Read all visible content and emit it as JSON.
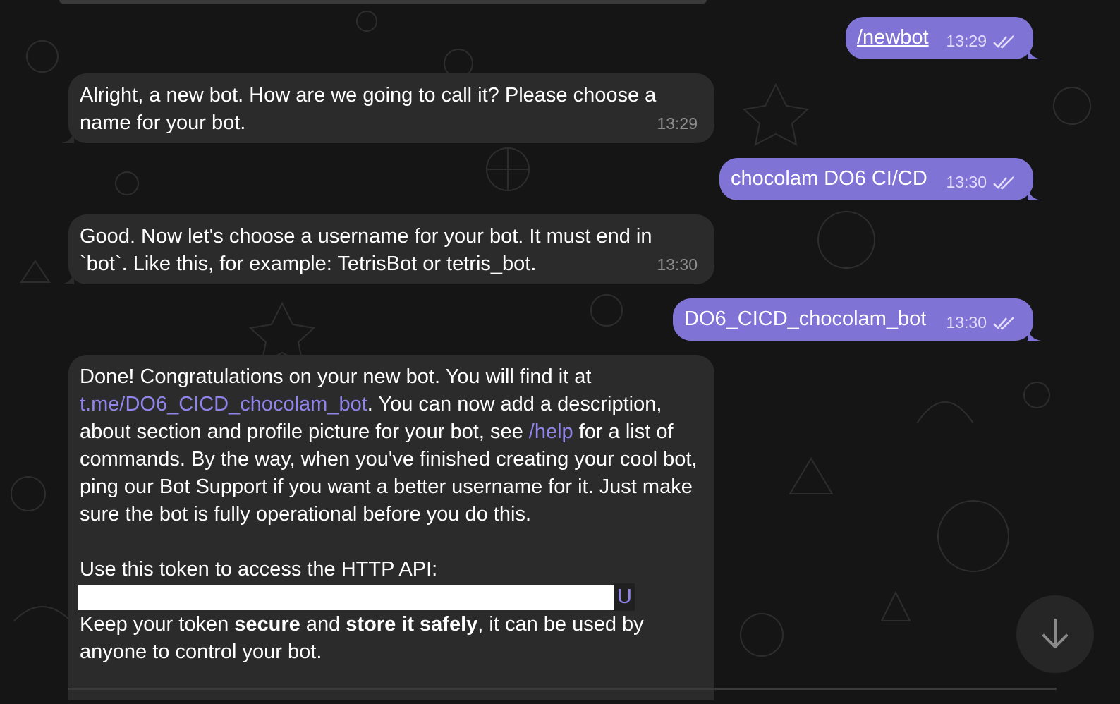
{
  "messages": [
    {
      "id": "m1",
      "dir": "out",
      "text": "/newbot",
      "time": "13:29"
    },
    {
      "id": "m2",
      "dir": "in",
      "text": "Alright, a new bot. How are we going to call it? Please choose a name for your bot.",
      "time": "13:29"
    },
    {
      "id": "m3",
      "dir": "out",
      "text": "chocolam DO6 CI/CD",
      "time": "13:30"
    },
    {
      "id": "m4",
      "dir": "in",
      "text": "Good. Now let's choose a username for your bot. It must end in `bot`. Like this, for example: TetrisBot or tetris_bot.",
      "time": "13:30"
    },
    {
      "id": "m5",
      "dir": "out",
      "text": "DO6_CICD_chocolam_bot",
      "time": "13:30"
    },
    {
      "id": "m6",
      "dir": "in",
      "p1_start": "Done! Congratulations on your new bot. You will find it at",
      "link_text": "t.me/DO6_CICD_chocolam_bot",
      "p1_mid": ". You can now add a description, about section and profile picture for your bot, see",
      "help_link": "/help",
      "p1_end": "for a list of commands. By the way, when you've finished creating your cool bot, ping our Bot Support if you want a better username for it. Just make sure the bot is fully operational before you do this.",
      "p2": "Use this token to access the HTTP API:",
      "token_visible_tail": "U",
      "p3_a": "Keep your token",
      "p3_b": "secure",
      "p3_c": "and",
      "p3_d": "store it safely",
      "p3_e": ", it can be used by anyone to control your bot."
    }
  ],
  "colors": {
    "outgoing": "#7f73d6",
    "incoming": "#2b2b2b",
    "background": "#151515",
    "link": "#8f84ea"
  },
  "icons": {
    "read_receipt": "double-check-icon",
    "scroll_down": "arrow-down-icon"
  }
}
